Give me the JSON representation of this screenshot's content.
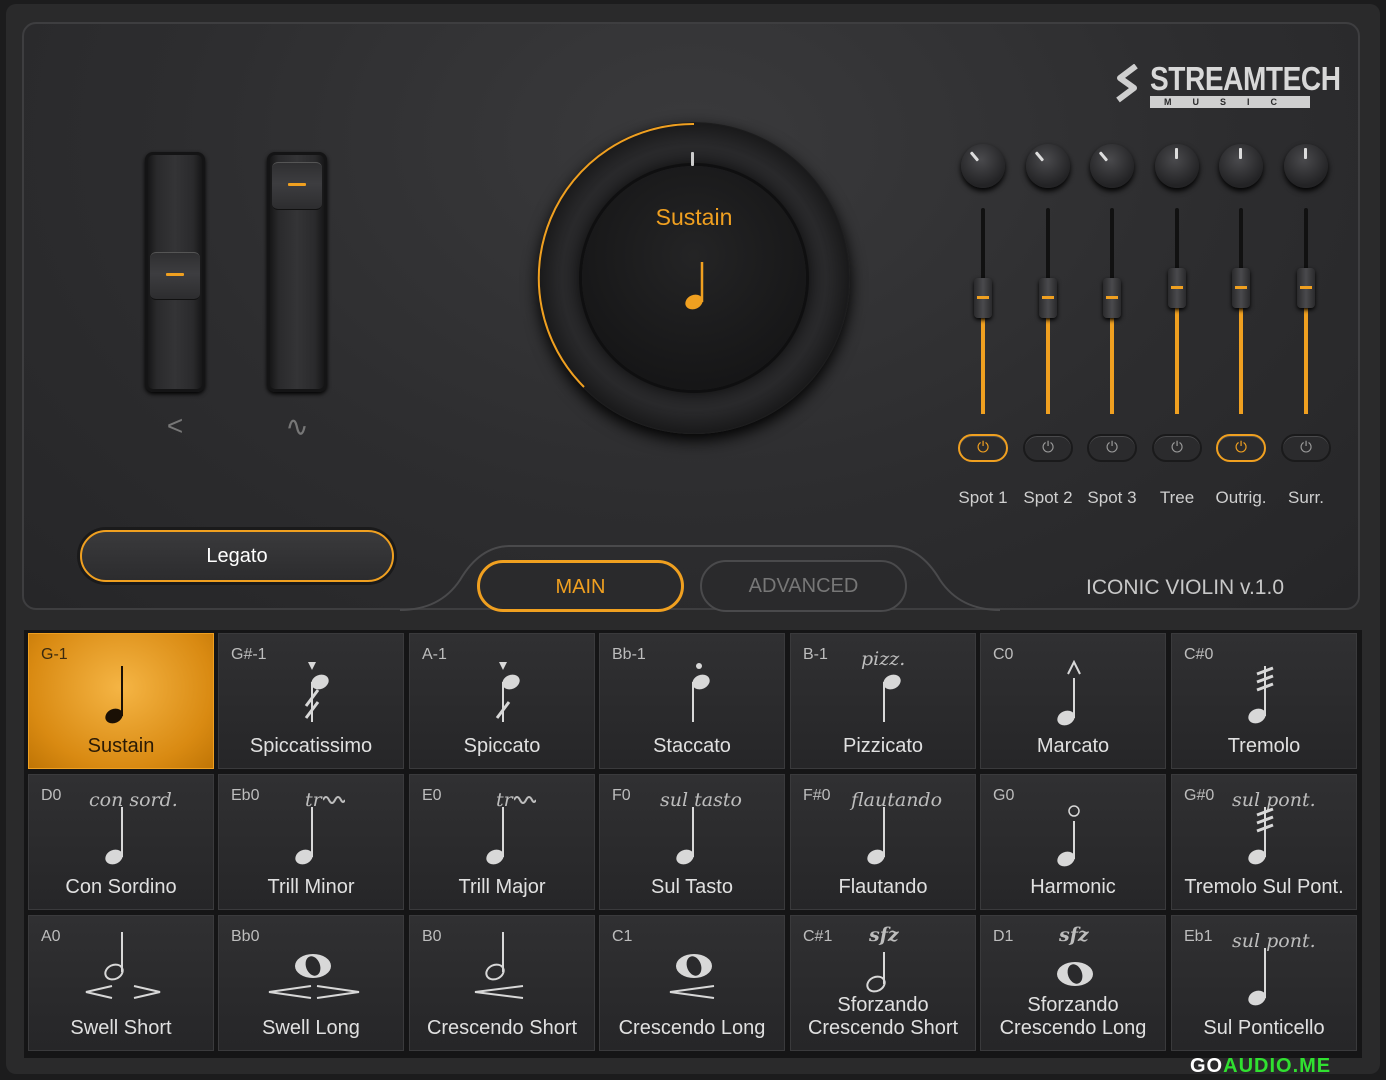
{
  "logo": {
    "name": "STREAMTECH",
    "sub": "MUSIC"
  },
  "sliders": [
    {
      "label": "<"
    },
    {
      "label": "∿"
    }
  ],
  "dial": {
    "title": "Sustain"
  },
  "channels": [
    {
      "label": "Spot 1",
      "on": true
    },
    {
      "label": "Spot 2",
      "on": false
    },
    {
      "label": "Spot 3",
      "on": false
    },
    {
      "label": "Tree",
      "on": false
    },
    {
      "label": "Outrig.",
      "on": true
    },
    {
      "label": "Surr.",
      "on": false
    }
  ],
  "power_icon": "⏻",
  "articulation_button": "Legato",
  "tabs": {
    "main": "MAIN",
    "advanced": "ADVANCED"
  },
  "version": "ICONIC VIOLIN v.1.0",
  "cells": [
    {
      "key": "G-1",
      "label": "Sustain",
      "mark": ""
    },
    {
      "key": "G#-1",
      "label": "Spiccatissimo",
      "mark": ""
    },
    {
      "key": "A-1",
      "label": "Spiccato",
      "mark": ""
    },
    {
      "key": "Bb-1",
      "label": "Staccato",
      "mark": ""
    },
    {
      "key": "B-1",
      "label": "Pizzicato",
      "mark": "pizz."
    },
    {
      "key": "C0",
      "label": "Marcato",
      "mark": ""
    },
    {
      "key": "C#0",
      "label": "Tremolo",
      "mark": ""
    },
    {
      "key": "D0",
      "label": "Con Sordino",
      "mark": "con sord."
    },
    {
      "key": "Eb0",
      "label": "Trill Minor",
      "mark": "tr"
    },
    {
      "key": "E0",
      "label": "Trill Major",
      "mark": "tr"
    },
    {
      "key": "F0",
      "label": "Sul Tasto",
      "mark": "sul tasto"
    },
    {
      "key": "F#0",
      "label": "Flautando",
      "mark": "flautando"
    },
    {
      "key": "G0",
      "label": "Harmonic",
      "mark": ""
    },
    {
      "key": "G#0",
      "label": "Tremolo Sul Pont.",
      "mark": "sul pont."
    },
    {
      "key": "A0",
      "label": "Swell Short",
      "mark": ""
    },
    {
      "key": "Bb0",
      "label": "Swell Long",
      "mark": ""
    },
    {
      "key": "B0",
      "label": "Crescendo Short",
      "mark": ""
    },
    {
      "key": "C1",
      "label": "Crescendo Long",
      "mark": ""
    },
    {
      "key": "C#1",
      "label": "Sforzando Crescendo Short",
      "label1": "Sforzando",
      "label2": "Crescendo Short",
      "mark": "sfz"
    },
    {
      "key": "D1",
      "label": "Sforzando Crescendo Long",
      "label1": "Sforzando",
      "label2": "Crescendo Long",
      "mark": "sfz"
    },
    {
      "key": "Eb1",
      "label": "Sul Ponticello",
      "mark": "sul pont."
    }
  ],
  "watermark": {
    "a": "GO",
    "b": "AUDIO.ME"
  }
}
